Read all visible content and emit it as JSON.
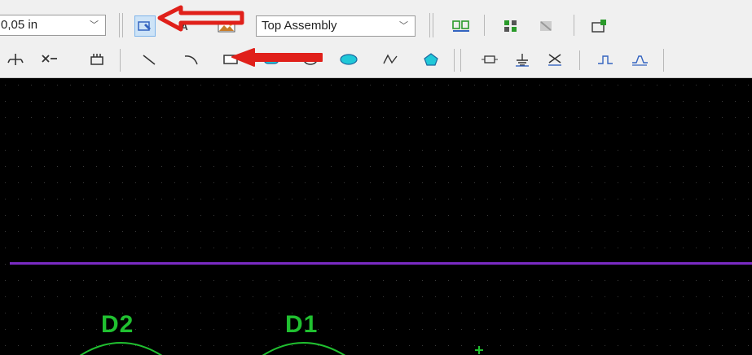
{
  "toolbar_top": {
    "grid_size": {
      "value": "0,05 in"
    },
    "layer_select": {
      "value": "Top Assembly"
    }
  },
  "canvas": {
    "background": "#000000",
    "grid_dot_color": "#3a3a3a",
    "board_edge_color": "#7a2bc4",
    "component_color": "#20c030",
    "components": [
      {
        "designator": "D2"
      },
      {
        "designator": "D1"
      }
    ]
  },
  "annotation_color": "#e0201a"
}
